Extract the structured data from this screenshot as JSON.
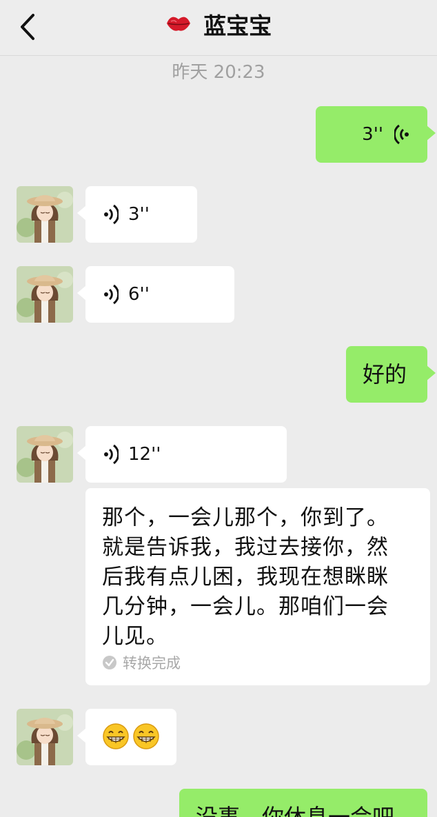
{
  "header": {
    "title": "蓝宝宝",
    "title_emoji": "kiss-lips-icon",
    "back_icon": "chevron-left-icon"
  },
  "timestamp": "昨天 20:23",
  "messages": [
    {
      "side": "right",
      "type": "voice",
      "duration": "3''"
    },
    {
      "side": "left",
      "type": "voice",
      "duration": "3''"
    },
    {
      "side": "left",
      "type": "voice",
      "duration": "6''"
    },
    {
      "side": "right",
      "type": "text",
      "text": "好的"
    },
    {
      "side": "left",
      "type": "voice",
      "duration": "12''",
      "transcript": "那个，一会儿那个，你到了。就是告诉我，我过去接你，然后我有点儿困，我现在想眯眯几分钟，一会儿。那咱们一会儿见。",
      "transcript_lines": [
        "那个，一会儿那个，你到了。",
        "就是告诉我，我过去接你，然",
        "后我有点儿困，我现在想眯眯",
        "几分钟，一会儿。那咱们一会",
        "儿见。"
      ],
      "transcript_status": "转换完成"
    },
    {
      "side": "left",
      "type": "emoji",
      "emoji": [
        "grin-emoji",
        "grin-emoji"
      ]
    },
    {
      "side": "right",
      "type": "text",
      "text": "没事，你休息一会吧"
    }
  ],
  "colors": {
    "background": "#ececec",
    "bubble_self": "#95ec69",
    "bubble_other": "#ffffff",
    "timestamp": "#a0a0a0"
  }
}
